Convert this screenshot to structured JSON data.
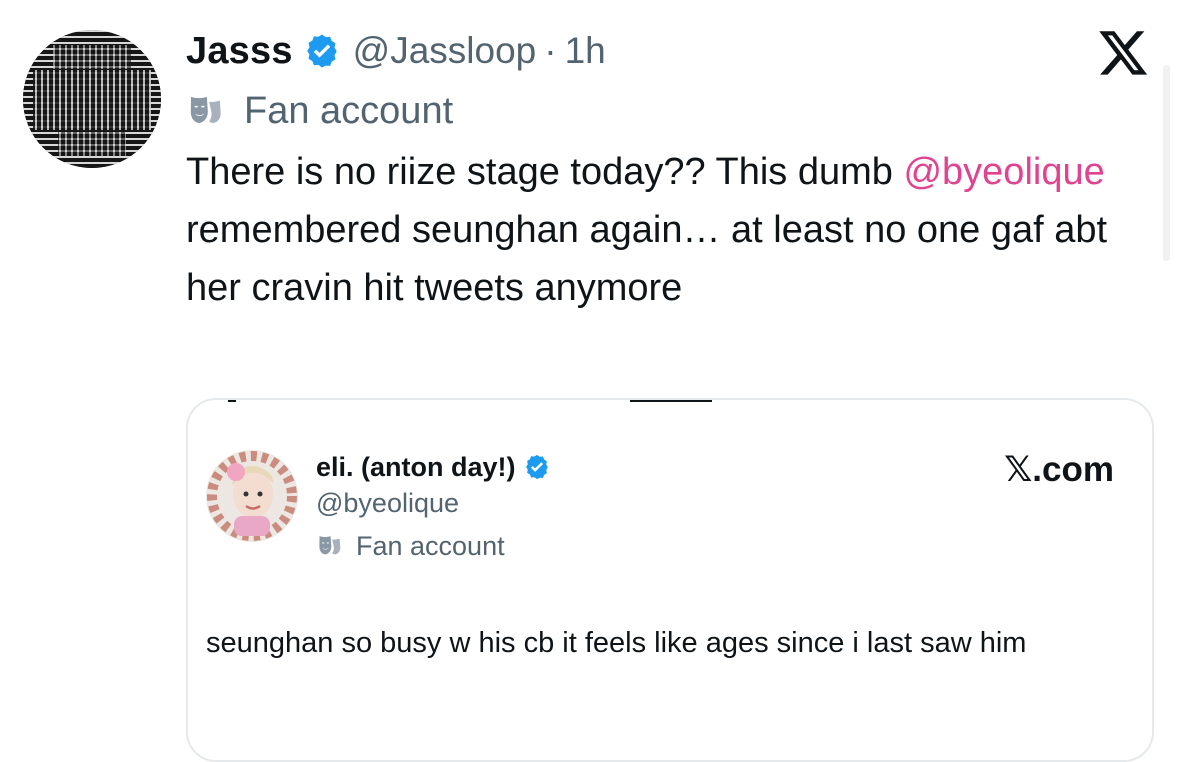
{
  "tweet": {
    "display_name": "Jasss",
    "handle": "@Jassloop",
    "separator": "·",
    "time": "1h",
    "account_label": "Fan account",
    "text": {
      "before_mention": "There is no riize stage today?? This dumb ",
      "mention": "@byeolique",
      "after_mention": " remembered seunghan again… at least no one gaf abt her cravin hit tweets anymore"
    }
  },
  "quoted": {
    "display_name": "eli. (anton day!)",
    "handle": "@byeolique",
    "account_label": "Fan account",
    "source": "𝕏.com",
    "text": "seunghan so busy w his cb it feels like ages since i last saw him"
  },
  "colors": {
    "text": "#0f1419",
    "secondary": "#536471",
    "mention": "#e0438f",
    "verified": "#1d9bf0",
    "card_border": "#e6e9ec"
  },
  "icons": {
    "verified": "verified-badge-icon",
    "account_label": "theater-mask-icon",
    "brand": "x-logo-icon"
  }
}
